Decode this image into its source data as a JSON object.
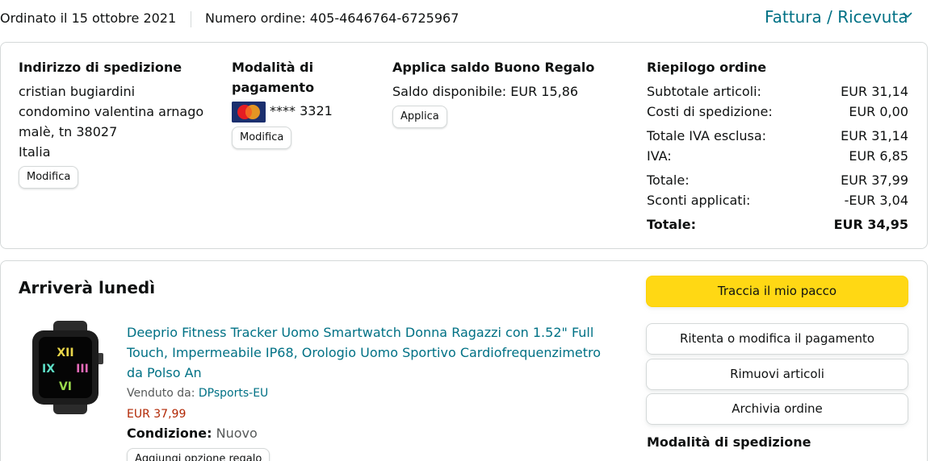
{
  "header": {
    "order_date": "Ordinato il 15 ottobre 2021",
    "order_number": "Numero ordine: 405-4646764-6725967",
    "invoice_link": "Fattura / Ricevuta"
  },
  "shipping_address": {
    "title": "Indirizzo di spedizione",
    "lines": [
      "cristian bugiardini",
      "condomino valentina arnago",
      "malè, tn 38027",
      "Italia"
    ],
    "edit_button": "Modifica"
  },
  "payment": {
    "title_line1": "Modalità di",
    "title_line2": "pagamento",
    "card_icon": "mastercard-icon",
    "card_digits": "**** 3321",
    "edit_button": "Modifica"
  },
  "gift_card": {
    "title": "Applica saldo Buono Regalo",
    "balance": "Saldo disponibile: EUR 15,86",
    "apply_button": "Applica"
  },
  "summary": {
    "title": "Riepilogo ordine",
    "rows": [
      {
        "label": "Subtotale articoli:",
        "value": "EUR 31,14"
      },
      {
        "label": "Costi di spedizione:",
        "value": "EUR 0,00"
      },
      {
        "label": "Totale IVA esclusa:",
        "value": "EUR 31,14"
      },
      {
        "label": "IVA:",
        "value": "EUR 6,85"
      },
      {
        "label": "Totale:",
        "value": "EUR 37,99"
      },
      {
        "label": "Sconti applicati:",
        "value": "-EUR 3,04"
      },
      {
        "label": "Totale:",
        "value": "EUR 34,95"
      }
    ]
  },
  "delivery": {
    "heading": "Arriverà lunedì",
    "product": {
      "title": "Deeprio Fitness Tracker Uomo Smartwatch Donna Ragazzi con 1.52\" Full Touch, Impermeabile IP68, Orologio Uomo Sportivo Cardiofrequenzimetro da Polso An",
      "sold_by_label": "Venduto da: ",
      "seller": "DPsports-EU",
      "price": "EUR 37,99",
      "condition_label": "Condizione:",
      "condition_value": "Nuovo",
      "gift_button": "Aggiungi opzione regalo"
    },
    "actions": {
      "track": "Traccia il mio pacco",
      "retry_payment": "Ritenta o modifica il pagamento",
      "remove_items": "Rimuovi articoli",
      "archive": "Archivia ordine"
    },
    "shipping_method_title": "Modalità di spedizione"
  },
  "colors": {
    "link": "#007185",
    "price": "#b12704",
    "primary_button": "#ffd814",
    "border": "#d5d9d9"
  }
}
